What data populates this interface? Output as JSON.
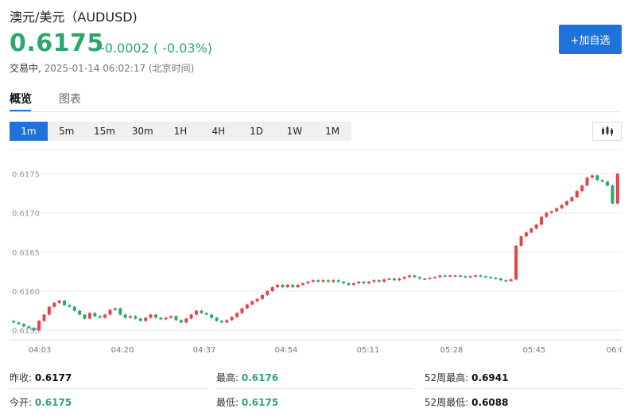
{
  "header": {
    "title": "澳元/美元（AUDUSD)",
    "price": "0.6175",
    "change": "-0.0002 ( -0.03%)",
    "status_label": "交易中,",
    "timestamp": "2025-01-14 06:02:17 (北京时间)",
    "add_button": "+加自选"
  },
  "tabs": [
    {
      "label": "概览",
      "active": true
    },
    {
      "label": "图表",
      "active": false
    }
  ],
  "periods": [
    "1m",
    "5m",
    "15m",
    "30m",
    "1H",
    "4H",
    "1D",
    "1W",
    "1M"
  ],
  "active_period": "1m",
  "colors": {
    "up": "#e8414a",
    "down": "#2aa86b",
    "accent": "#1f73d8"
  },
  "chart_data": {
    "type": "candlestick",
    "x_tick_labels": [
      "04:03",
      "04:20",
      "04:37",
      "04:54",
      "05:11",
      "05:28",
      "05:45",
      "06:0"
    ],
    "y_tick_labels": [
      "0.6175",
      "0.6170",
      "0.6165",
      "0.6160",
      "0.6155"
    ],
    "y_ticks": [
      0.6175,
      0.617,
      0.6165,
      0.616,
      0.6155
    ],
    "ylim": [
      0.61538,
      0.61782
    ],
    "closes": [
      0.6156,
      0.61558,
      0.61555,
      0.61553,
      0.6155,
      0.61562,
      0.6157,
      0.6158,
      0.61585,
      0.61588,
      0.61582,
      0.6158,
      0.61575,
      0.6157,
      0.61565,
      0.61572,
      0.61568,
      0.61566,
      0.6157,
      0.61576,
      0.61578,
      0.6157,
      0.61566,
      0.61568,
      0.61565,
      0.61562,
      0.61566,
      0.6157,
      0.61566,
      0.61564,
      0.61566,
      0.61568,
      0.61563,
      0.6156,
      0.61565,
      0.6157,
      0.61575,
      0.61572,
      0.6157,
      0.61566,
      0.61562,
      0.6156,
      0.61563,
      0.61567,
      0.61572,
      0.61578,
      0.61583,
      0.61587,
      0.6159,
      0.61595,
      0.616,
      0.61605,
      0.61608,
      0.61605,
      0.61608,
      0.61605,
      0.61608,
      0.6161,
      0.61612,
      0.61614,
      0.61612,
      0.61614,
      0.61612,
      0.61614,
      0.61612,
      0.6161,
      0.61608,
      0.6161,
      0.61612,
      0.6161,
      0.61612,
      0.61614,
      0.61612,
      0.61615,
      0.61616,
      0.61614,
      0.61616,
      0.61618,
      0.6162,
      0.61618,
      0.61616,
      0.61616,
      0.61617,
      0.61618,
      0.6162,
      0.61619,
      0.6162,
      0.6162,
      0.61619,
      0.61618,
      0.61619,
      0.6162,
      0.61619,
      0.61618,
      0.61617,
      0.61616,
      0.61614,
      0.61613,
      0.61615,
      0.61658,
      0.6167,
      0.61675,
      0.6168,
      0.61685,
      0.61695,
      0.617,
      0.61702,
      0.61706,
      0.6171,
      0.61715,
      0.6172,
      0.61728,
      0.61735,
      0.61745,
      0.61748,
      0.61742,
      0.6174,
      0.61735,
      0.61712,
      0.6175
    ],
    "high": "0.6176",
    "low": "0.6175"
  },
  "stats": {
    "prev_close_label": "昨收:",
    "prev_close": "0.6177",
    "open_label": "今开:",
    "open": "0.6175",
    "high_label": "最高:",
    "high": "0.6176",
    "low_label": "最低:",
    "low": "0.6175",
    "w52_high_label": "52周最高:",
    "w52_high": "0.6941",
    "w52_low_label": "52周最低:",
    "w52_low": "0.6088"
  }
}
